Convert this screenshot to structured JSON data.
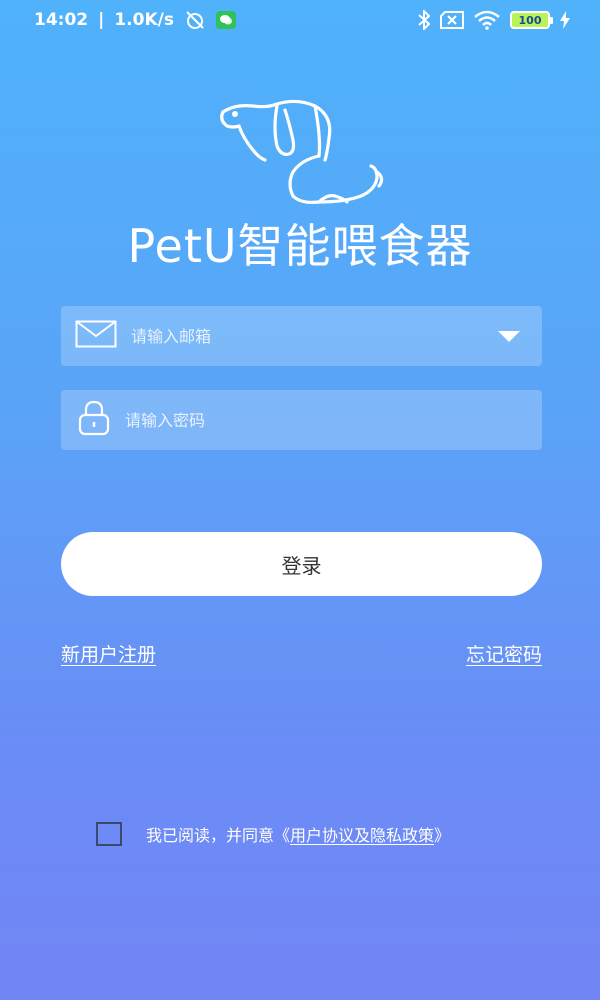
{
  "status_bar": {
    "time": "14:02",
    "network_speed": "1.0K/s",
    "battery_level": "100",
    "icons": [
      "alarm-off-icon",
      "wechat-icon",
      "bluetooth-icon",
      "sim-x-icon",
      "wifi-icon",
      "battery-icon",
      "charging-icon"
    ]
  },
  "app": {
    "title": "PetU智能喂食器",
    "logo": "dog-logo-icon"
  },
  "login_form": {
    "email_placeholder": "请输入邮箱",
    "email_value": "",
    "password_placeholder": "请输入密码",
    "password_value": "",
    "login_label": "登录"
  },
  "links": {
    "register": "新用户注册",
    "forgot_password": "忘记密码"
  },
  "agreement": {
    "checked": false,
    "prefix": "我已阅读，并同意",
    "open_bracket": "《",
    "link_text": "用户协议及隐私政策",
    "close_bracket": "》"
  },
  "colors": {
    "gradient_top": "#4fb2fa",
    "gradient_bottom": "#7386f5",
    "button_bg": "#ffffff",
    "button_text": "#333333"
  }
}
